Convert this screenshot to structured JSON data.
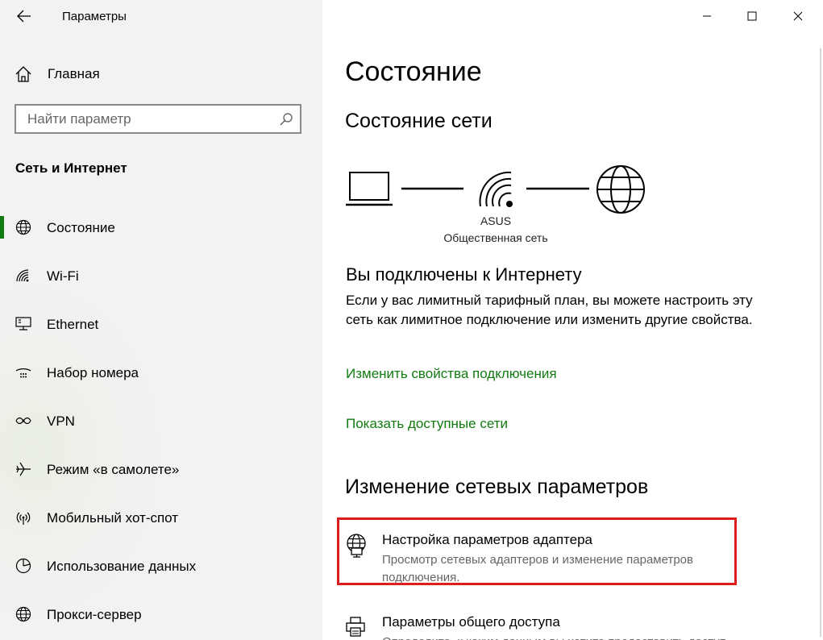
{
  "window": {
    "app_title": "Параметры",
    "controls": {
      "minimize": "minimize-icon",
      "maximize": "maximize-icon",
      "close": "close-icon"
    }
  },
  "sidebar": {
    "home_label": "Главная",
    "search_placeholder": "Найти параметр",
    "section_title": "Сеть и Интернет",
    "items": [
      {
        "label": "Состояние",
        "icon": "globe-icon",
        "active": true
      },
      {
        "label": "Wi-Fi",
        "icon": "wifi-icon",
        "active": false
      },
      {
        "label": "Ethernet",
        "icon": "ethernet-icon",
        "active": false
      },
      {
        "label": "Набор номера",
        "icon": "dialup-icon",
        "active": false
      },
      {
        "label": "VPN",
        "icon": "vpn-icon",
        "active": false
      },
      {
        "label": "Режим «в самолете»",
        "icon": "airplane-icon",
        "active": false
      },
      {
        "label": "Мобильный хот-спот",
        "icon": "hotspot-icon",
        "active": false
      },
      {
        "label": "Использование данных",
        "icon": "data-usage-icon",
        "active": false
      },
      {
        "label": "Прокси-сервер",
        "icon": "proxy-globe-icon",
        "active": false
      }
    ],
    "accent_color": "#107c10"
  },
  "main": {
    "title": "Состояние",
    "network_status_heading": "Состояние сети",
    "network_name": "ASUS",
    "network_type": "Общественная сеть",
    "connected_heading": "Вы подключены к Интернету",
    "connected_text": "Если у вас лимитный тарифный план, вы можете настроить эту сеть как лимитное подключение или изменить другие свойства.",
    "link_change_props": "Изменить свойства подключения",
    "link_show_networks": "Показать доступные сети",
    "change_settings_heading": "Изменение сетевых параметров",
    "options": [
      {
        "title": "Настройка параметров адаптера",
        "desc": "Просмотр сетевых адаптеров и изменение параметров подключения.",
        "icon": "adapter-globe-icon"
      },
      {
        "title": "Параметры общего доступа",
        "desc": "Определите, к каким данным вы хотите предоставить доступ",
        "icon": "sharing-printer-icon"
      }
    ],
    "link_color": "#107c10",
    "highlight_color": "#e01b1b"
  }
}
